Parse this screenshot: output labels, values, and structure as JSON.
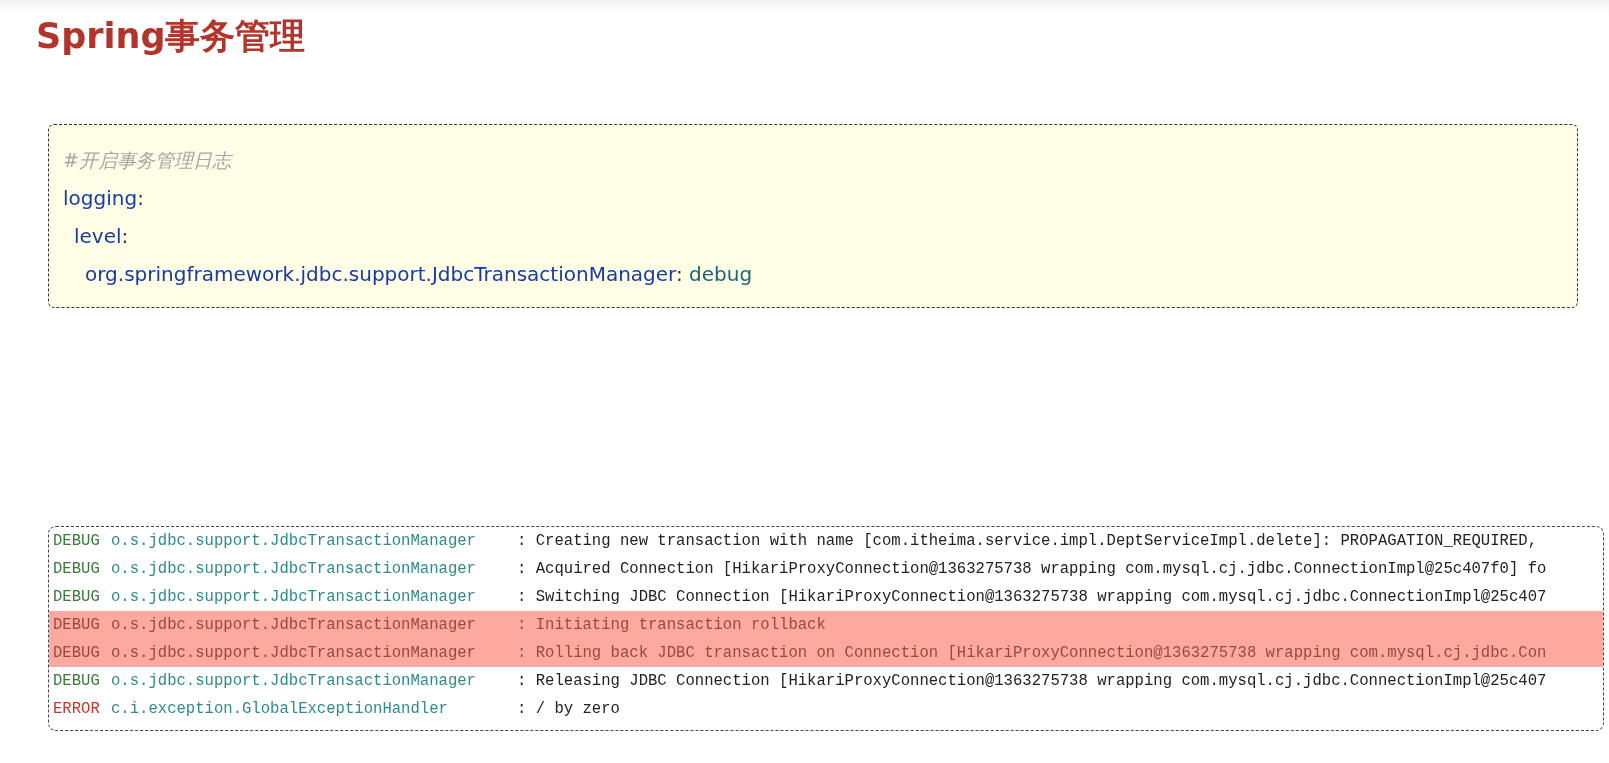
{
  "title": "Spring事务管理",
  "config": {
    "comment": "#开启事务管理日志",
    "entries": [
      {
        "key": "logging",
        "separator": ":",
        "children": [
          {
            "key": "level",
            "separator": ":",
            "children": [
              {
                "key": "org.springframework.jdbc.support.JdbcTransactionManager",
                "separator": ":",
                "value": "debug"
              }
            ]
          }
        ]
      }
    ]
  },
  "log": [
    {
      "level": "DEBUG",
      "kind": "debug",
      "logger": "o.s.jdbc.support.JdbcTransactionManager",
      "message": ": Creating new transaction with name [com.itheima.service.impl.DeptServiceImpl.delete]: PROPAGATION_REQUIRED,",
      "highlighted": false
    },
    {
      "level": "DEBUG",
      "kind": "debug",
      "logger": "o.s.jdbc.support.JdbcTransactionManager",
      "message": ": Acquired Connection [HikariProxyConnection@1363275738 wrapping com.mysql.cj.jdbc.ConnectionImpl@25c407f0] fo",
      "highlighted": false
    },
    {
      "level": "DEBUG",
      "kind": "debug",
      "logger": "o.s.jdbc.support.JdbcTransactionManager",
      "message": ": Switching JDBC Connection [HikariProxyConnection@1363275738 wrapping com.mysql.cj.jdbc.ConnectionImpl@25c407",
      "highlighted": false
    },
    {
      "level": "DEBUG",
      "kind": "debug",
      "logger": "o.s.jdbc.support.JdbcTransactionManager",
      "message": ": Initiating transaction rollback",
      "highlighted": true
    },
    {
      "level": "DEBUG",
      "kind": "debug",
      "logger": "o.s.jdbc.support.JdbcTransactionManager",
      "message": ": Rolling back JDBC transaction on Connection [HikariProxyConnection@1363275738 wrapping com.mysql.cj.jdbc.Con",
      "highlighted": true
    },
    {
      "level": "DEBUG",
      "kind": "debug",
      "logger": "o.s.jdbc.support.JdbcTransactionManager",
      "message": ": Releasing JDBC Connection [HikariProxyConnection@1363275738 wrapping com.mysql.cj.jdbc.ConnectionImpl@25c407",
      "highlighted": false
    },
    {
      "level": "ERROR",
      "kind": "error",
      "logger": "c.i.exception.GlobalExceptionHandler",
      "message": ": / by zero",
      "highlighted": false
    }
  ]
}
